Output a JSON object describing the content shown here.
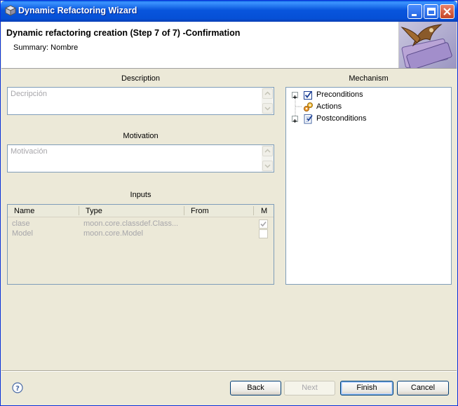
{
  "window": {
    "title": "Dynamic Refactoring Wizard"
  },
  "header": {
    "title": "Dynamic refactoring creation (Step 7 of 7) -Confirmation",
    "summary": "Summary: Nombre"
  },
  "description": {
    "label": "Description",
    "placeholder": "Decripción"
  },
  "motivation": {
    "label": "Motivation",
    "placeholder": "Motivación"
  },
  "inputs": {
    "label": "Inputs",
    "columns": [
      "Name",
      "Type",
      "From",
      "M"
    ],
    "rows": [
      {
        "name": "clase",
        "type": "moon.core.classdef.Class...",
        "from": "",
        "m_checked": true
      },
      {
        "name": "Model",
        "type": "moon.core.Model",
        "from": "",
        "m_checked": false
      }
    ]
  },
  "mechanism": {
    "label": "Mechanism",
    "items": [
      {
        "label": "Preconditions",
        "icon": "checkbox-check-icon",
        "expandable": true
      },
      {
        "label": "Actions",
        "icon": "gears-icon",
        "expandable": false
      },
      {
        "label": "Postconditions",
        "icon": "checklist-icon",
        "expandable": true
      }
    ]
  },
  "footer": {
    "back_label": "Back",
    "next_label": "Next",
    "finish_label": "Finish",
    "cancel_label": "Cancel"
  },
  "colors": {
    "titlebar": "#0855dd",
    "background": "#ece9d8",
    "border": "#7f9db9"
  }
}
